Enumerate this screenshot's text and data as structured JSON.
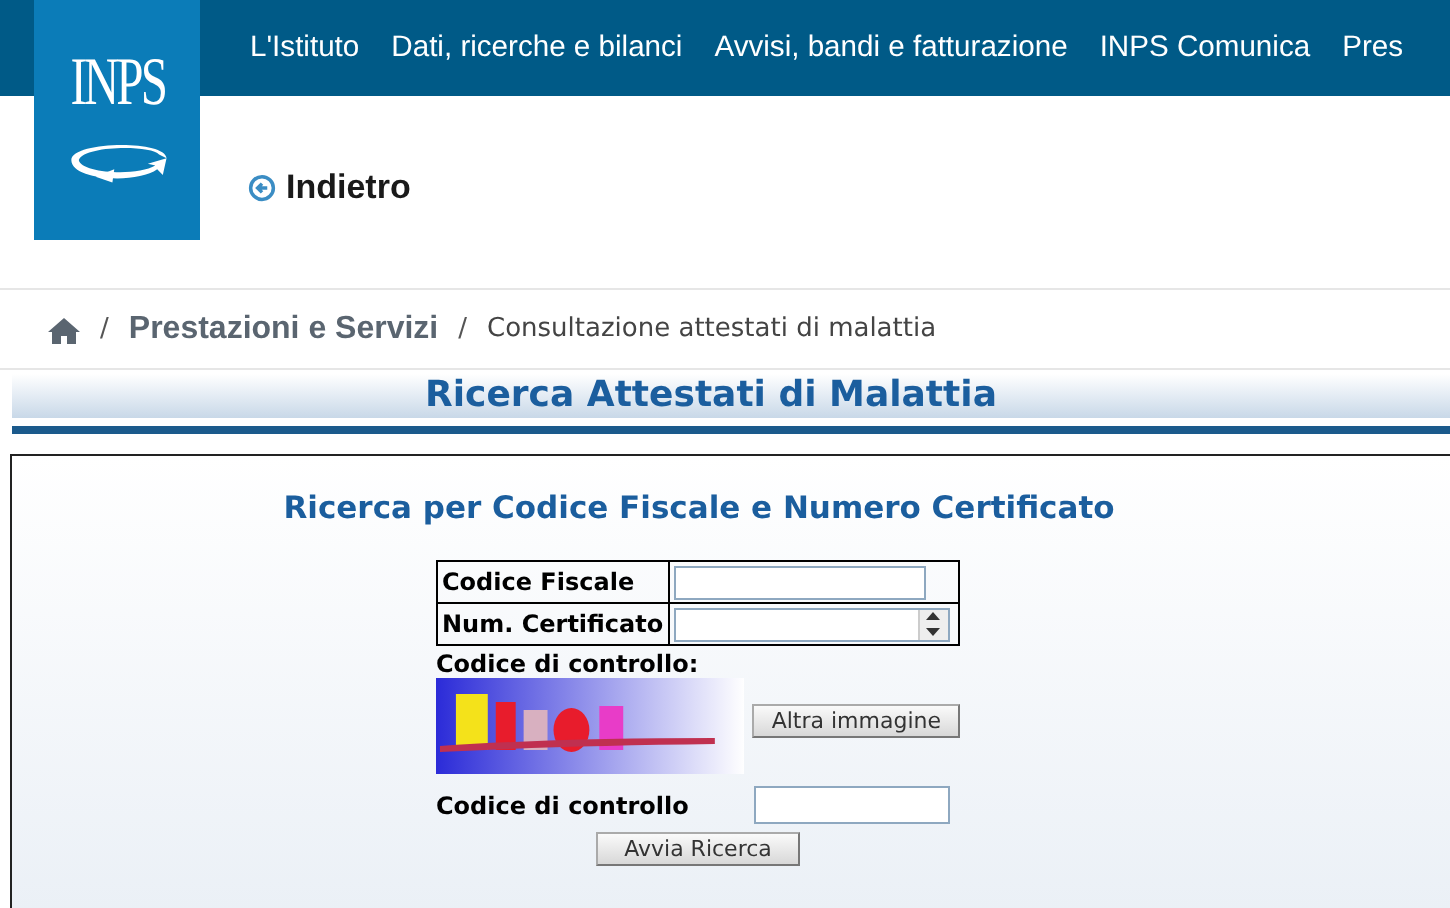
{
  "header": {
    "logo_text": "INPS",
    "nav": [
      "L'Istituto",
      "Dati, ricerche e bilanci",
      "Avvisi, bandi e fatturazione",
      "INPS Comunica",
      "Pres"
    ]
  },
  "back_link": "Indietro",
  "breadcrumb": [
    {
      "separator": "/",
      "label": "Prestazioni e Servizi"
    },
    {
      "separator": "/",
      "label": "Consultazione attestati di malattia"
    }
  ],
  "page_title": "Ricerca Attestati di Malattia",
  "form": {
    "heading": "Ricerca per Codice Fiscale e Numero Certificato",
    "fields": [
      {
        "label": "Codice Fiscale",
        "kind": "text"
      },
      {
        "label": "Num. Certificato",
        "kind": "spinner"
      }
    ],
    "captcha_label": "Codice di controllo:",
    "refresh_button": "Altra immagine",
    "code_label": "Codice di controllo",
    "submit_button": "Avvia Ricerca"
  }
}
